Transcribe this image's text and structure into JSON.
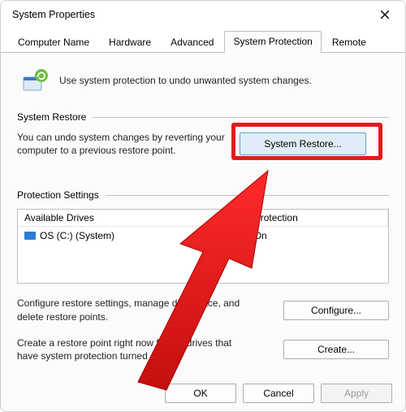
{
  "window": {
    "title": "System Properties"
  },
  "tabs": [
    {
      "label": "Computer Name"
    },
    {
      "label": "Hardware"
    },
    {
      "label": "Advanced"
    },
    {
      "label": "System Protection",
      "active": true
    },
    {
      "label": "Remote"
    }
  ],
  "intro": {
    "text": "Use system protection to undo unwanted system changes."
  },
  "groups": {
    "restore": {
      "title": "System Restore",
      "text": "You can undo system changes by reverting your computer to a previous restore point.",
      "button": "System Restore..."
    },
    "protection": {
      "title": "Protection Settings",
      "columns": {
        "a": "Available Drives",
        "b": "Protection"
      },
      "rows": [
        {
          "drive": "OS (C:) (System)",
          "status": "On"
        }
      ],
      "configure": {
        "text": "Configure restore settings, manage disk space, and delete restore points.",
        "button": "Configure..."
      },
      "create": {
        "text": "Create a restore point right now for the drives that have system protection turned on.",
        "button": "Create..."
      }
    }
  },
  "footer": {
    "ok": "OK",
    "cancel": "Cancel",
    "apply": "Apply"
  },
  "annotation": {
    "highlight_target": "system-restore-button",
    "arrow_color": "#e21b1b"
  }
}
